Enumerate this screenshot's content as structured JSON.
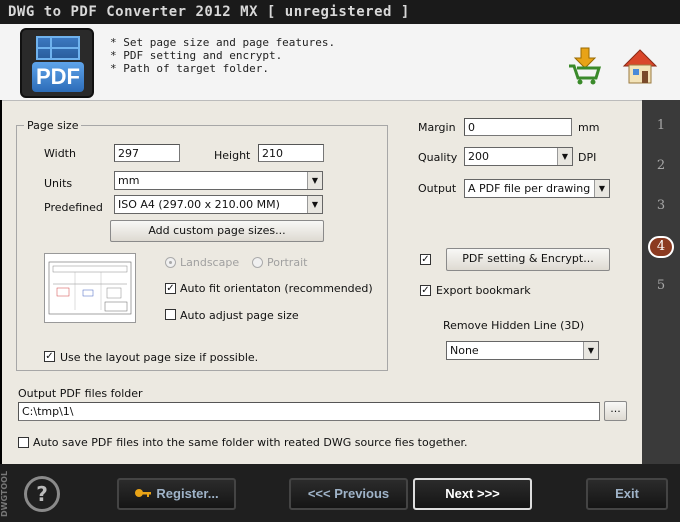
{
  "window": {
    "title": "DWG to PDF Converter 2012 MX [ unregistered ]"
  },
  "header": {
    "logo_text": "PDF",
    "tips": [
      "* Set page size and page features.",
      "* PDF setting and encrypt.",
      "* Path of target folder."
    ],
    "cart_icon": "shopping-cart-download-icon",
    "home_icon": "home-icon"
  },
  "steps": [
    "1",
    "2",
    "3",
    "4",
    "5"
  ],
  "active_step": "4",
  "page_size": {
    "title": "Page size",
    "width_label": "Width",
    "width_value": "297",
    "height_label": "Height",
    "height_value": "210",
    "units_label": "Units",
    "units_value": "mm",
    "predefined_label": "Predefined",
    "predefined_value": "ISO A4 (297.00 x 210.00 MM)",
    "add_custom_label": "Add custom page sizes...",
    "landscape_label": "Landscape",
    "portrait_label": "Portrait",
    "auto_fit_label": "Auto fit orientaton (recommended)",
    "auto_adjust_label": "Auto adjust page size",
    "use_layout_label": "Use the layout page size if possible."
  },
  "right": {
    "margin_label": "Margin",
    "margin_value": "0",
    "margin_unit": "mm",
    "quality_label": "Quality",
    "quality_value": "200",
    "quality_unit": "DPI",
    "output_label": "Output",
    "output_value": "A PDF file per drawing",
    "pdf_setting_label": "PDF setting & Encrypt...",
    "export_bookmark_label": "Export bookmark",
    "remove_hidden_label": "Remove Hidden Line (3D)",
    "remove_hidden_value": "None"
  },
  "output": {
    "folder_label": "Output PDF files folder",
    "folder_value": "C:\\tmp\\1\\",
    "browse_label": "...",
    "auto_save_label": "Auto save PDF files into the same folder with reated DWG source fies together."
  },
  "footer": {
    "help_label": "?",
    "register_label": "Register...",
    "previous_label": "<<< Previous",
    "next_label": "Next >>>",
    "exit_label": "Exit",
    "brand": "DWGTOOL"
  }
}
